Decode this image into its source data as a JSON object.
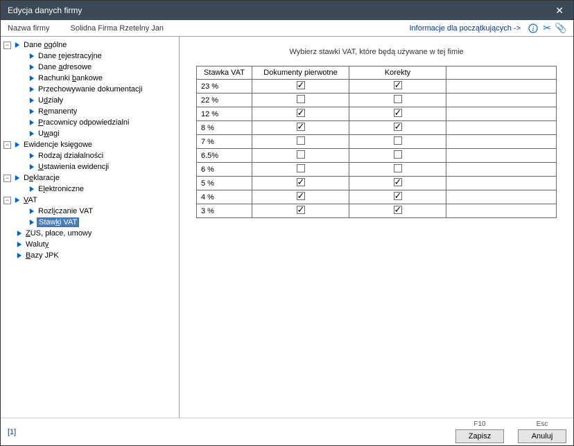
{
  "window": {
    "title": "Edycja danych firmy"
  },
  "toolbar": {
    "nameLabel": "Nazwa firmy",
    "nameValue": "Solidna Firma Rzetelny Jan",
    "helpLink": "Informacje dla początkujących ->"
  },
  "tree": {
    "daneOgolne": {
      "label": "Dane <u>o</u>gólne"
    },
    "daneRejestracyjne": {
      "label": "Dane <u>r</u>ejestracyjne"
    },
    "daneAdresowe": {
      "label": "Dane <u>a</u>dresowe"
    },
    "rachunkiBankowe": {
      "label": "Rachunki <u>b</u>ankowe"
    },
    "przechowywanie": {
      "label": "Przechowywanie dokumentacji"
    },
    "udzialy": {
      "label": "U<u>d</u>ziały"
    },
    "remanenty": {
      "label": "R<u>e</u>manenty"
    },
    "pracownicy": {
      "label": "<u>P</u>racownicy odpowiedzialni"
    },
    "uwagi": {
      "label": "U<u>w</u>agi"
    },
    "ewidencje": {
      "label": "Ewidencje księgowe"
    },
    "rodzaj": {
      "label": "Rodza<u>j</u> działalności"
    },
    "ustawienia": {
      "label": "<u>U</u>stawienia ewidencji"
    },
    "deklaracje": {
      "label": "D<u>e</u>klaracje"
    },
    "elektroniczne": {
      "label": "E<u>l</u>ektroniczne"
    },
    "vat": {
      "label": "<u>V</u>AT"
    },
    "rozliczanie": {
      "label": "Rozl<u>i</u>czanie VAT"
    },
    "stawki": {
      "label": "Staw<u>k</u>i VAT"
    },
    "zus": {
      "label": "<u>Z</u>US, płace, umowy"
    },
    "waluty": {
      "label": "Walut<u>y</u>"
    },
    "bazy": {
      "label": "<u>B</u>azy JPK"
    }
  },
  "main": {
    "title": "Wybierz stawki VAT, które będą używane w tej fimie",
    "headers": {
      "rate": "Stawka VAT",
      "docs": "Dokumenty pierwotne",
      "corr": "Korekty"
    },
    "rows": [
      {
        "rate": "23 %",
        "docs": true,
        "corr": true
      },
      {
        "rate": "22 %",
        "docs": false,
        "corr": false
      },
      {
        "rate": "12 %",
        "docs": true,
        "corr": true
      },
      {
        "rate": "8  %",
        "docs": true,
        "corr": true
      },
      {
        "rate": "7  %",
        "docs": false,
        "corr": false
      },
      {
        "rate": "6.5%",
        "docs": false,
        "corr": false
      },
      {
        "rate": "6  %",
        "docs": false,
        "corr": false
      },
      {
        "rate": "5  %",
        "docs": true,
        "corr": true
      },
      {
        "rate": "4  %",
        "docs": true,
        "corr": true
      },
      {
        "rate": "3  %",
        "docs": true,
        "corr": true
      }
    ]
  },
  "footer": {
    "page": "[1]",
    "saveHint": "F10",
    "saveLabel": "Zapisz",
    "cancelHint": "Esc",
    "cancelLabel": "Anuluj"
  }
}
